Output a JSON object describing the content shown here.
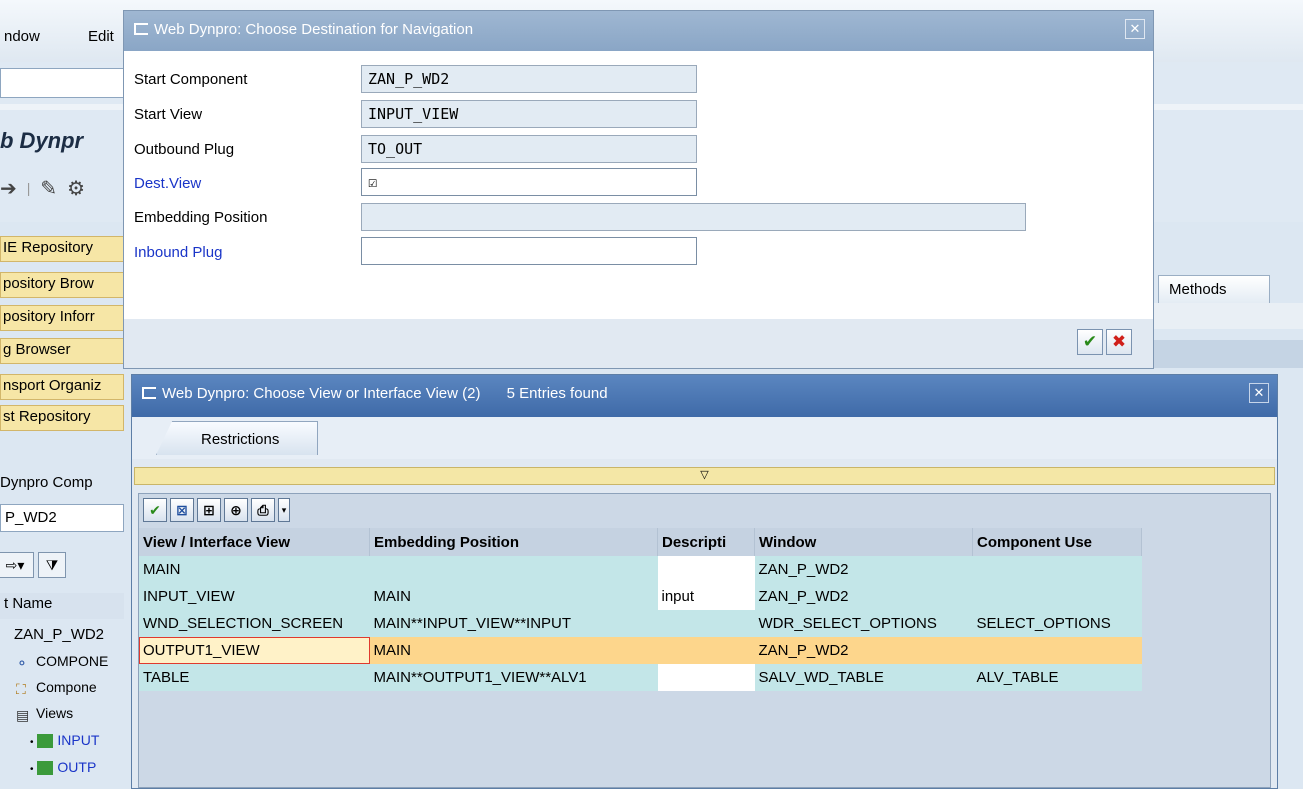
{
  "menubar": {
    "items": [
      "ndow",
      "Edit"
    ]
  },
  "background": {
    "title": "b Dynpr",
    "repo_buttons": [
      "IE Repository",
      "pository Brow",
      "pository Inforr",
      "g Browser",
      "nsport Organiz",
      "st Repository"
    ],
    "methods_tab": "Methods",
    "component_label": "Dynpro Comp",
    "component_value": "P_WD2",
    "tree_header": "t Name",
    "tree_rows": [
      "ZAN_P_WD2",
      "COMPONE",
      "Compone",
      "Views",
      "INPUT",
      "OUTP"
    ]
  },
  "dialog1": {
    "title": "Web Dynpro: Choose Destination for Navigation",
    "fields": [
      {
        "label": "Start Component",
        "value": "ZAN_P_WD2"
      },
      {
        "label": "Start View",
        "value": "INPUT_VIEW"
      },
      {
        "label": "Outbound Plug",
        "value": "TO_OUT"
      },
      {
        "label": "Dest.View",
        "value": "☑"
      },
      {
        "label": "Embedding Position",
        "value": ""
      },
      {
        "label": "Inbound Plug",
        "value": ""
      }
    ]
  },
  "dialog2": {
    "title": "Web Dynpro: Choose View or Interface View (2)",
    "entries_found": "5 Entries found",
    "tab_label": "Restrictions",
    "columns": [
      "View / Interface View",
      "Embedding Position",
      "Descripti",
      "Window",
      "Component Use"
    ],
    "rows": [
      [
        "MAIN",
        "",
        "",
        "ZAN_P_WD2",
        ""
      ],
      [
        "INPUT_VIEW",
        "MAIN",
        "input",
        "ZAN_P_WD2",
        ""
      ],
      [
        "WND_SELECTION_SCREEN",
        "MAIN**INPUT_VIEW**INPUT",
        "",
        "WDR_SELECT_OPTIONS",
        "SELECT_OPTIONS"
      ],
      [
        "OUTPUT1_VIEW",
        "MAIN",
        "",
        "ZAN_P_WD2",
        ""
      ],
      [
        "TABLE",
        "MAIN**OUTPUT1_VIEW**ALV1",
        "",
        "SALV_WD_TABLE",
        "ALV_TABLE"
      ]
    ]
  },
  "colors": {
    "selected_row": "#fdd68c",
    "row_bg": "#c3e6e8",
    "link_label": "#1a35c8",
    "title_bar_active": "#4a74b0"
  }
}
